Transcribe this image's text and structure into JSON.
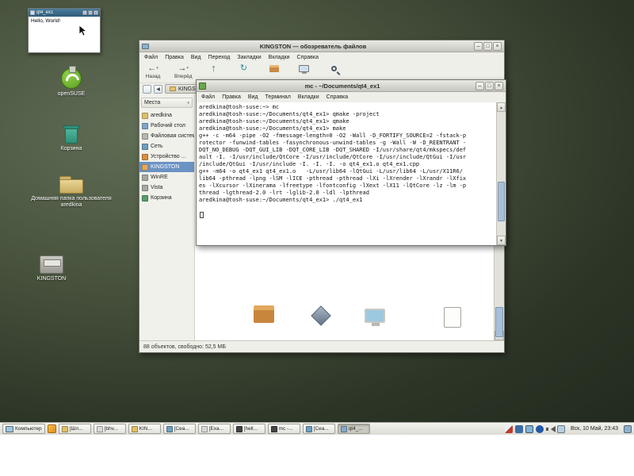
{
  "window_controls": {
    "minimize": "–",
    "maximize": "□",
    "close": "×"
  },
  "glyphs": {
    "back": "←",
    "forward": "→",
    "up": "↑",
    "reload": "↻",
    "dropdown": "▾",
    "left": "◀",
    "scroll_up": "▲",
    "scroll_down": "▼"
  },
  "hello_window": {
    "title": "qt4_ex1",
    "body_text": "Hello, World!"
  },
  "desktop_icons": [
    {
      "label": "openSUSE"
    },
    {
      "label": "Корзина"
    },
    {
      "label": "Домашняя папка пользователя aredkina"
    },
    {
      "label": "KINGSTON"
    }
  ],
  "file_manager": {
    "title": "KINGSTON — обозреватель файлов",
    "menu": [
      "Файл",
      "Правка",
      "Вид",
      "Переход",
      "Закладки",
      "Вкладки",
      "Справка"
    ],
    "back_label": "Назад",
    "forward_label": "Вперёд",
    "breadcrumb": "KINGSTON",
    "places_header": "Места",
    "places": [
      "aredkina",
      "Рабочий стол",
      "Файловая система",
      "Сеть",
      "Устройство ...",
      "KINGSTON",
      "WinRE",
      "Vista",
      "Корзина"
    ],
    "status": "88 объектов, свободно: 52,5 МБ"
  },
  "terminal": {
    "title": "mc - ~/Documents/qt4_ex1",
    "menu": [
      "Файл",
      "Правка",
      "Вид",
      "Терминал",
      "Вкладки",
      "Справка"
    ],
    "output": "aredkina@tosh-suse:~> mc\naredkina@tosh-suse:~/Documents/qt4_ex1> qmake -project\naredkina@tosh-suse:~/Documents/qt4_ex1> qmake\naredkina@tosh-suse:~/Documents/qt4_ex1> make\ng++ -c -m64 -pipe -O2 -fmessage-length=0 -O2 -Wall -D_FORTIFY_SOURCE=2 -fstack-p\nrotector -funwind-tables -fasynchronous-unwind-tables -g -Wall -W -D_REENTRANT -\nDQT_NO_DEBUG -DQT_GUI_LIB -DQT_CORE_LIB -DQT_SHARED -I/usr/share/qt4/mkspecs/def\nault -I. -I/usr/include/QtCore -I/usr/include/QtCore -I/usr/include/QtGui -I/usr\n/include/QtGui -I/usr/include -I. -I. -I. -o qt4_ex1.o qt4_ex1.cpp\ng++ -m64 -o qt4_ex1 qt4_ex1.o   -L/usr/lib64 -lQtGui -L/usr/lib64 -L/usr/X11R6/\nlib64 -pthread -lpng -lSM -lICE -pthread -pthread -lXi -lXrender -lXrandr -lXfix\nes -lXcursor -lXinerama -lfreetype -lfontconfig -lXext -lX11 -lQtCore -lz -lm -p\nthread -lgthread-2.0 -lrt -lglib-2.0 -ldl -lpthread\naredkina@tosh-suse:~/Documents/qt4_ex1> ./qt4_ex1"
  },
  "taskbar": {
    "computer_label": "Компьютер",
    "tasks": [
      {
        "label": "[Шл..."
      },
      {
        "label": "[bhv..."
      },
      {
        "label": "KIN..."
      },
      {
        "label": "[Сеа..."
      },
      {
        "label": "[Exa..."
      },
      {
        "label": "[hell..."
      },
      {
        "label": "mc -..."
      },
      {
        "label": "[Сеа..."
      },
      {
        "label": "qt4_..."
      }
    ],
    "clock": "Вск, 10 Май, 23:43"
  }
}
